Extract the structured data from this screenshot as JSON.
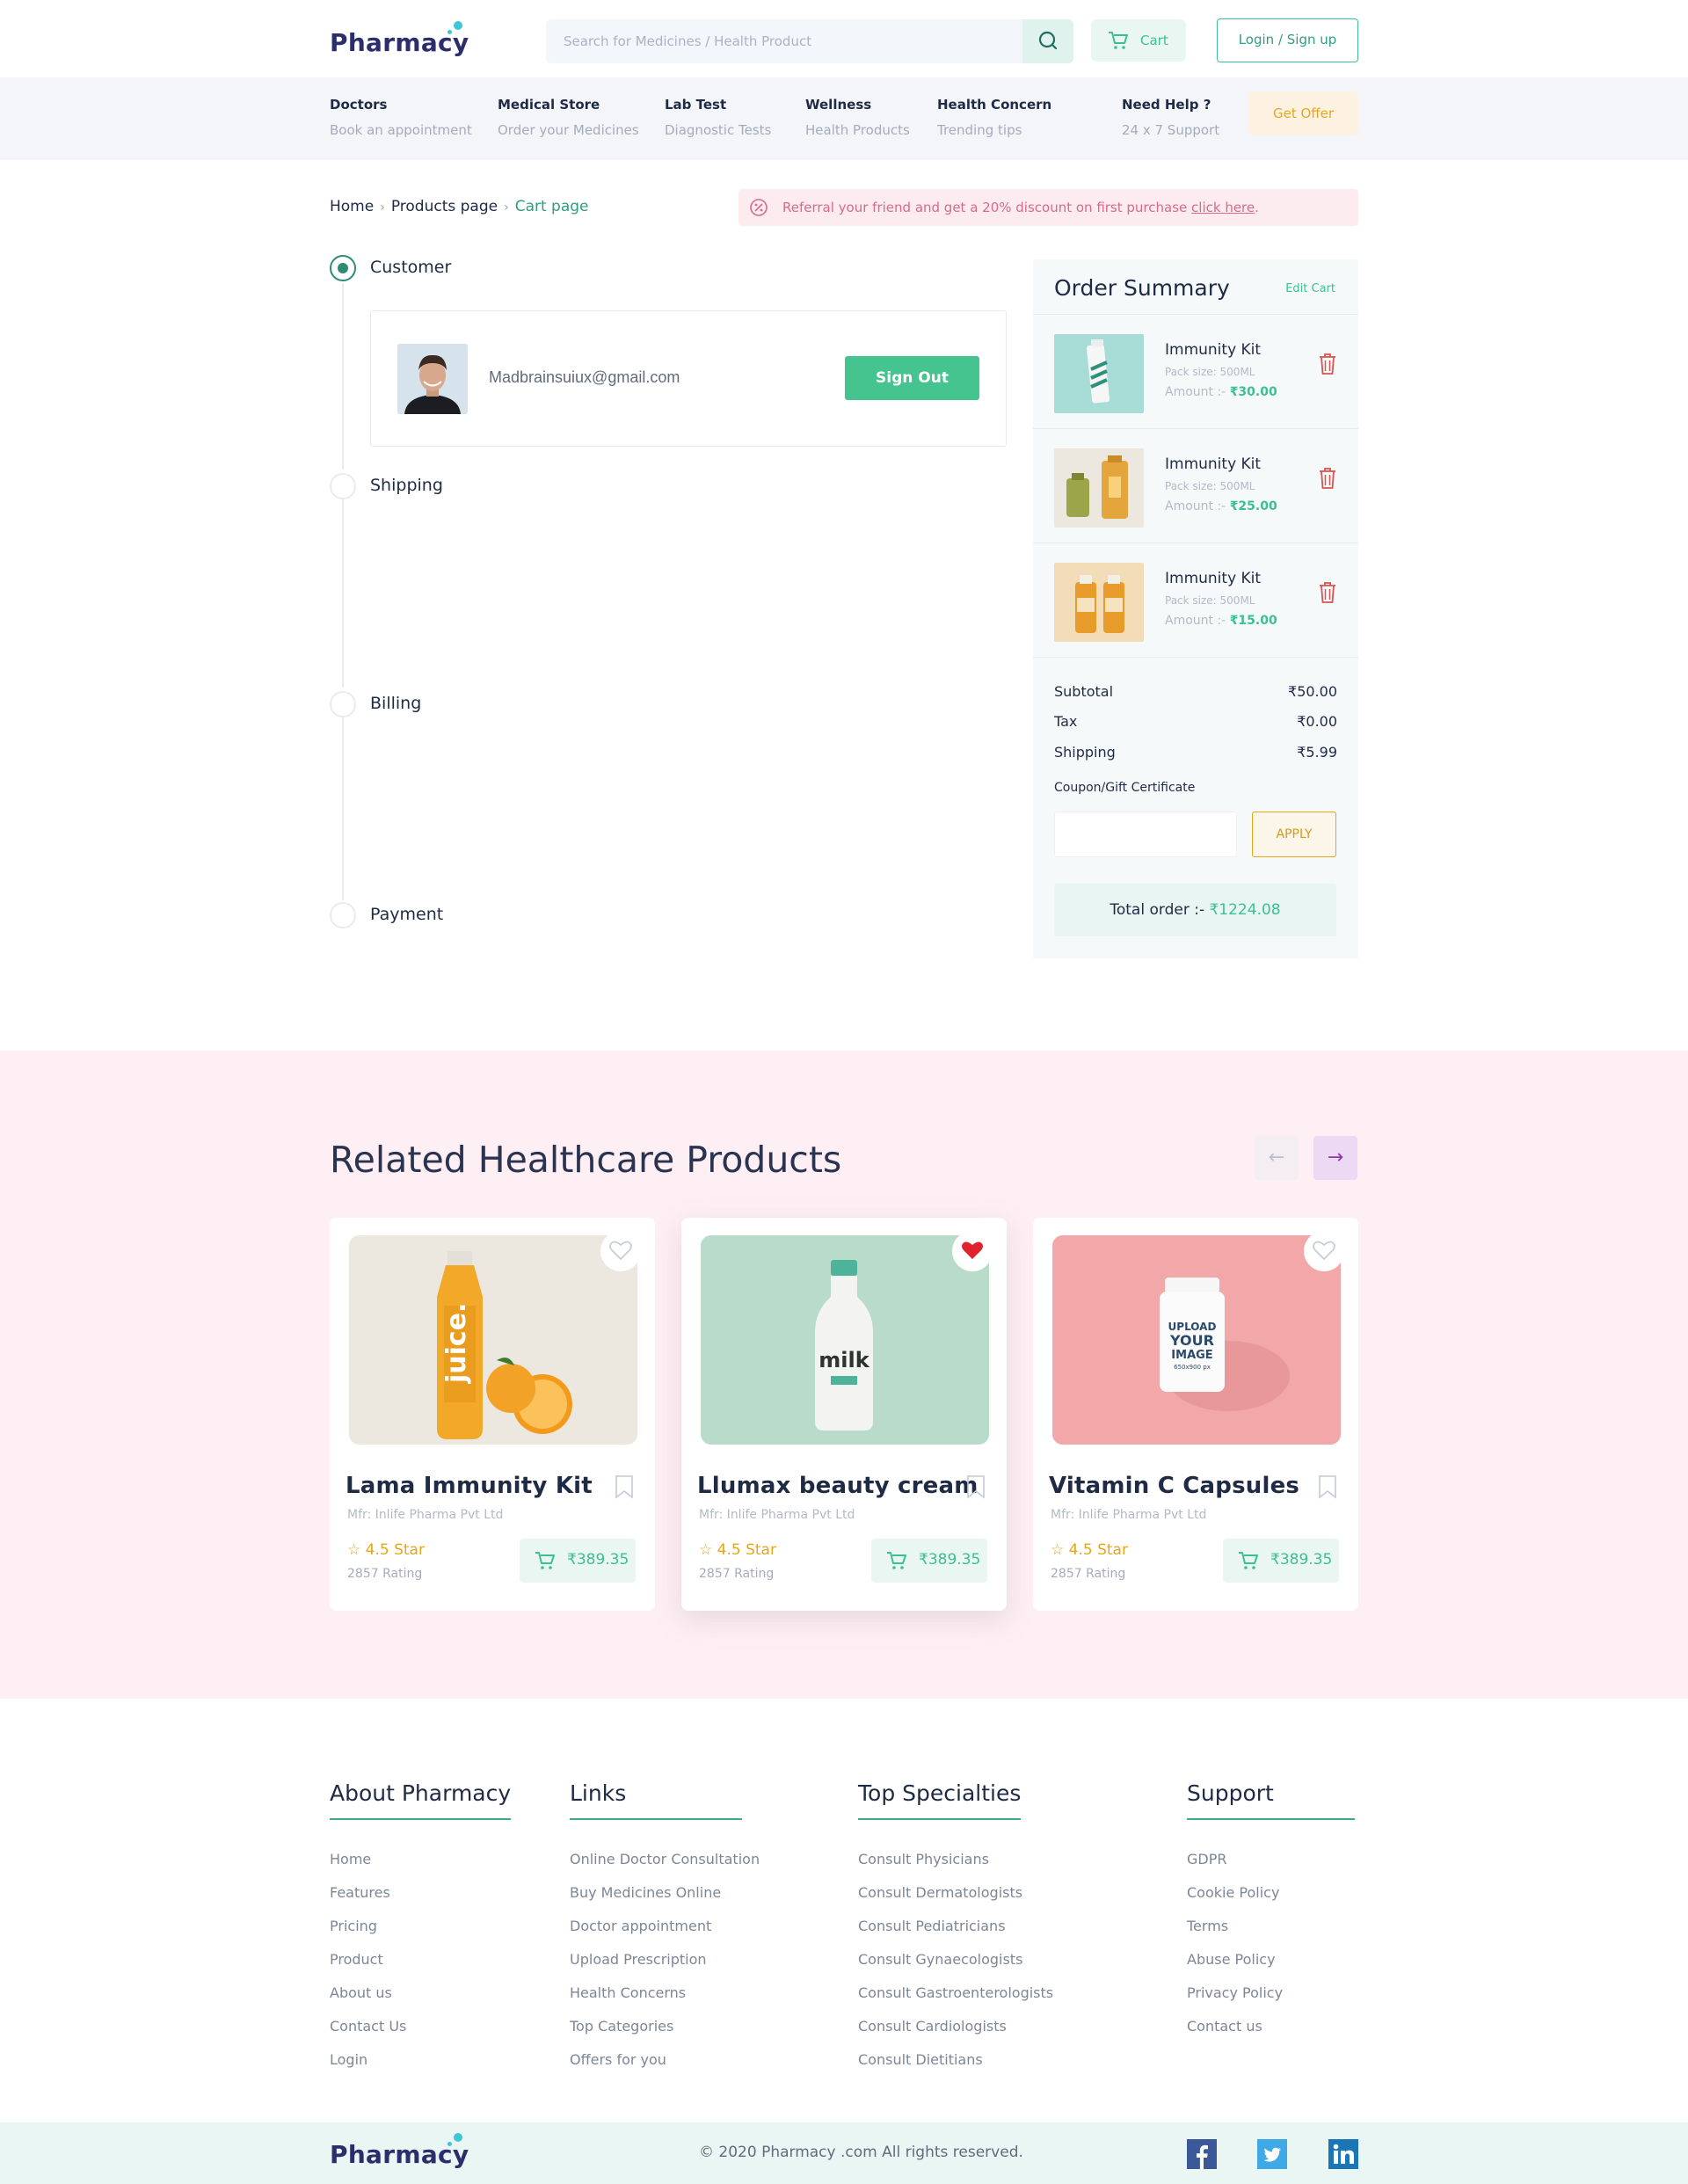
{
  "brand": {
    "name": "Pharmacy",
    "accent": "#3cbf94",
    "primary": "#2b2e6b"
  },
  "header": {
    "search_placeholder": "Search for Medicines / Health Product",
    "cart_label": "Cart",
    "login_label": "Login / Sign up"
  },
  "nav": {
    "items": [
      {
        "title": "Doctors",
        "subtitle": "Book an appointment"
      },
      {
        "title": "Medical Store",
        "subtitle": "Order your Medicines"
      },
      {
        "title": "Lab Test",
        "subtitle": "Diagnostic Tests"
      },
      {
        "title": "Wellness",
        "subtitle": "Health Products"
      },
      {
        "title": "Health Concern",
        "subtitle": "Trending tips"
      },
      {
        "title": "Need Help ?",
        "subtitle": "24 x 7 Support"
      }
    ],
    "offer_label": "Get Offer"
  },
  "breadcrumb": {
    "home": "Home",
    "products": "Products page",
    "current": "Cart page"
  },
  "referral": {
    "text": "Referral your friend and get a 20% discount on first purchase ",
    "link": "click here",
    "end": "."
  },
  "steps": {
    "customer": "Customer",
    "shipping": "Shipping",
    "billing": "Billing",
    "payment": "Payment"
  },
  "customer": {
    "email": "Madbrainsuiux@gmail.com",
    "signout_label": "Sign Out"
  },
  "summary": {
    "title": "Order Summary",
    "edit_label": "Edit Cart",
    "items": [
      {
        "name": "Immunity Kit",
        "pack": "Pack size: 500ML",
        "amount_label": "Amount :-",
        "amount": "₹30.00"
      },
      {
        "name": "Immunity Kit",
        "pack": "Pack size: 500ML",
        "amount_label": "Amount :-",
        "amount": "₹25.00"
      },
      {
        "name": "Immunity Kit",
        "pack": "Pack size: 500ML",
        "amount_label": "Amount :-",
        "amount": "₹15.00"
      }
    ],
    "subtotal_label": "Subtotal",
    "subtotal": "₹50.00",
    "tax_label": "Tax",
    "tax": "₹0.00",
    "shipping_label": "Shipping",
    "shipping": "₹5.99",
    "coupon_label": "Coupon/Gift Certificate",
    "apply_label": "APPLY",
    "total_label": "Total order :-",
    "total": "₹1224.08"
  },
  "related": {
    "title": "Related Healthcare Products",
    "prev_icon": "arrow-left-icon",
    "next_icon": "arrow-right-icon",
    "products": [
      {
        "name": "Lama Immunity Kit",
        "mfr": "Mfr: Inlife Pharma Pvt Ltd",
        "star": "4.5 Star",
        "rating": "2857 Rating",
        "price": "₹389.35",
        "favorited": false
      },
      {
        "name": "Llumax beauty cream",
        "mfr": "Mfr: Inlife Pharma Pvt Ltd",
        "star": "4.5 Star",
        "rating": "2857 Rating",
        "price": "₹389.35",
        "favorited": true
      },
      {
        "name": "Vitamin C Capsules",
        "mfr": "Mfr: Inlife Pharma Pvt Ltd",
        "star": "4.5 Star",
        "rating": "2857 Rating",
        "price": "₹389.35",
        "favorited": false
      }
    ],
    "image_text": {
      "juice": "juice.",
      "milk": "milk",
      "upload": "UPLOAD",
      "your": "YOUR",
      "image": "IMAGE",
      "size": "650x900 px"
    }
  },
  "footer": {
    "about": {
      "title": "About Pharmacy",
      "links": [
        "Home",
        "Features",
        "Pricing",
        "Product",
        "About us",
        "Contact Us",
        "Login"
      ]
    },
    "links": {
      "title": "Links",
      "links": [
        "Online Doctor Consultation",
        "Buy Medicines Online",
        "Doctor appointment",
        "Upload Prescription",
        "Health Concerns",
        "Top Categories",
        "Offers for you"
      ]
    },
    "specialties": {
      "title": "Top Specialties",
      "links": [
        "Consult Physicians",
        "Consult Dermatologists",
        "Consult Pediatricians",
        "Consult Gynaecologists",
        "Consult Gastroenterologists",
        "Consult Cardiologists",
        "Consult Dietitians"
      ]
    },
    "support": {
      "title": "Support",
      "links": [
        "GDPR",
        "Cookie Policy",
        "Terms",
        "Abuse Policy",
        "Privacy Policy",
        "Contact us"
      ]
    },
    "copyright": "© 2020 Pharmacy .com All rights reserved.",
    "social": [
      "facebook-icon",
      "twitter-icon",
      "linkedin-icon"
    ]
  }
}
